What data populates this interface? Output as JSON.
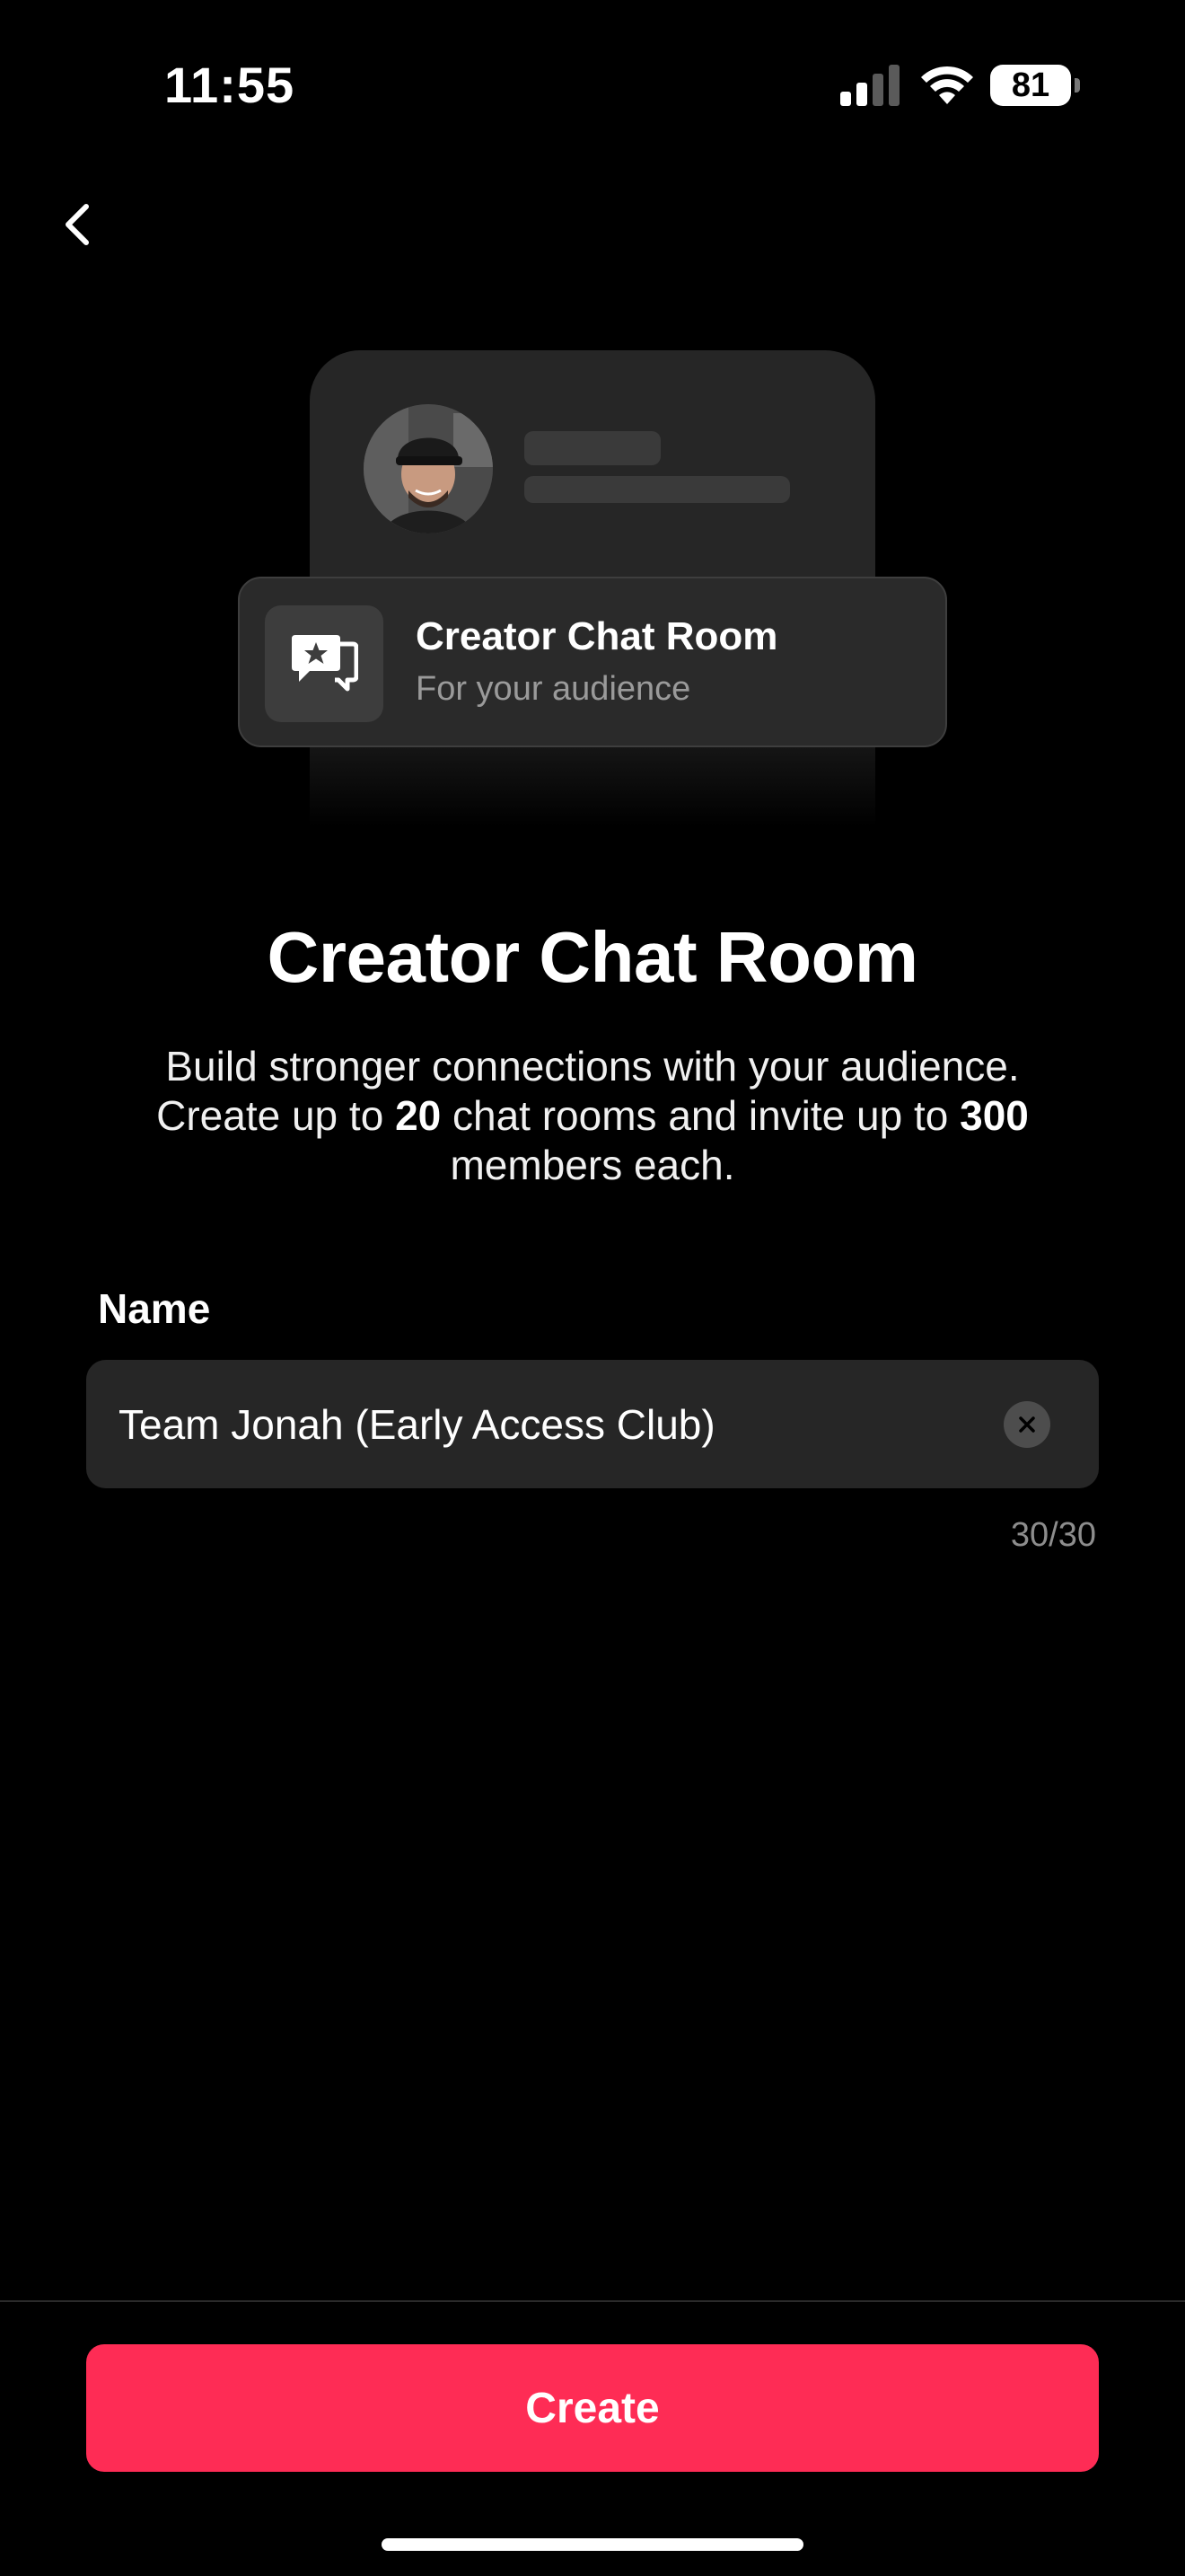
{
  "status_bar": {
    "time": "11:55",
    "battery": "81",
    "icons": [
      "signal-icon",
      "wifi-icon",
      "battery-icon"
    ]
  },
  "nav": {
    "back_icon": "chevron-left-icon"
  },
  "preview": {
    "title": "Creator Chat Room",
    "subtitle": "For your audience",
    "icon": "chat-star-icon"
  },
  "page": {
    "title": "Creator Chat Room",
    "description_line1": "Build stronger connections with your audience.",
    "description_line2_prefix": "Create up to ",
    "room_limit": "20",
    "description_line2_middle": " chat rooms and invite up to ",
    "member_limit": "300",
    "description_line3": "members each."
  },
  "form": {
    "name_label": "Name",
    "name_value": "Team Jonah (Early Access Club)",
    "char_counter": "30/30",
    "clear_icon": "clear-x-icon"
  },
  "actions": {
    "create_label": "Create"
  },
  "colors": {
    "background": "#000000",
    "accent": "#fe2c55",
    "field": "#262626",
    "muted_text": "#8d8d8d"
  }
}
